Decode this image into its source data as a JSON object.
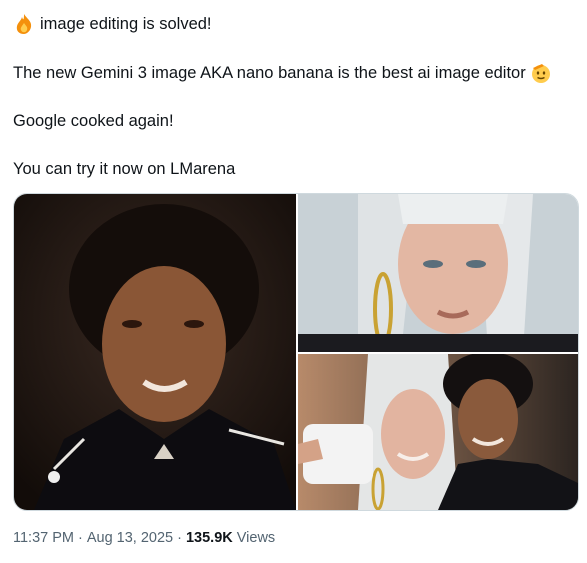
{
  "post": {
    "lines": [
      "image editing is solved!",
      "The new Gemini 3 image AKA nano banana is the best ai image editor",
      "Google cooked again!",
      "You can try it now on LMarena"
    ],
    "icons": {
      "line1": "fire-emoji",
      "line2": "saluting-face-emoji"
    }
  },
  "meta": {
    "time": "11:37 PM",
    "date": "Aug 13, 2025",
    "views_count": "135.9K",
    "views_label": "Views",
    "separator": "·"
  },
  "media": {
    "images": [
      "man-portrait-photo",
      "woman-platinum-hair-portrait-photo",
      "selfie-couple-photo"
    ]
  }
}
